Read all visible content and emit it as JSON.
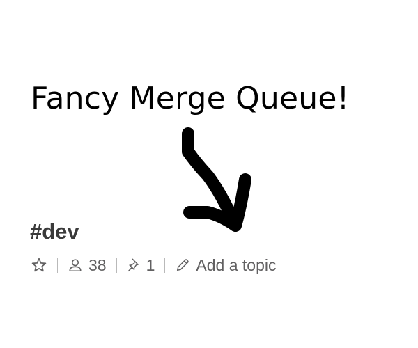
{
  "annotation": {
    "text": "Fancy Merge Queue!"
  },
  "channel": {
    "name": "#dev",
    "star_icon": "star-icon",
    "members": {
      "icon": "member-icon",
      "count": "38"
    },
    "pins": {
      "icon": "pin-icon",
      "count": "1"
    },
    "topic": {
      "icon": "pencil-icon",
      "label": "Add a topic"
    }
  },
  "colors": {
    "annotation_ink": "#000000",
    "channel_name": "#3a3a3a",
    "meta_text": "#616061",
    "separator": "#b9b9b9"
  }
}
